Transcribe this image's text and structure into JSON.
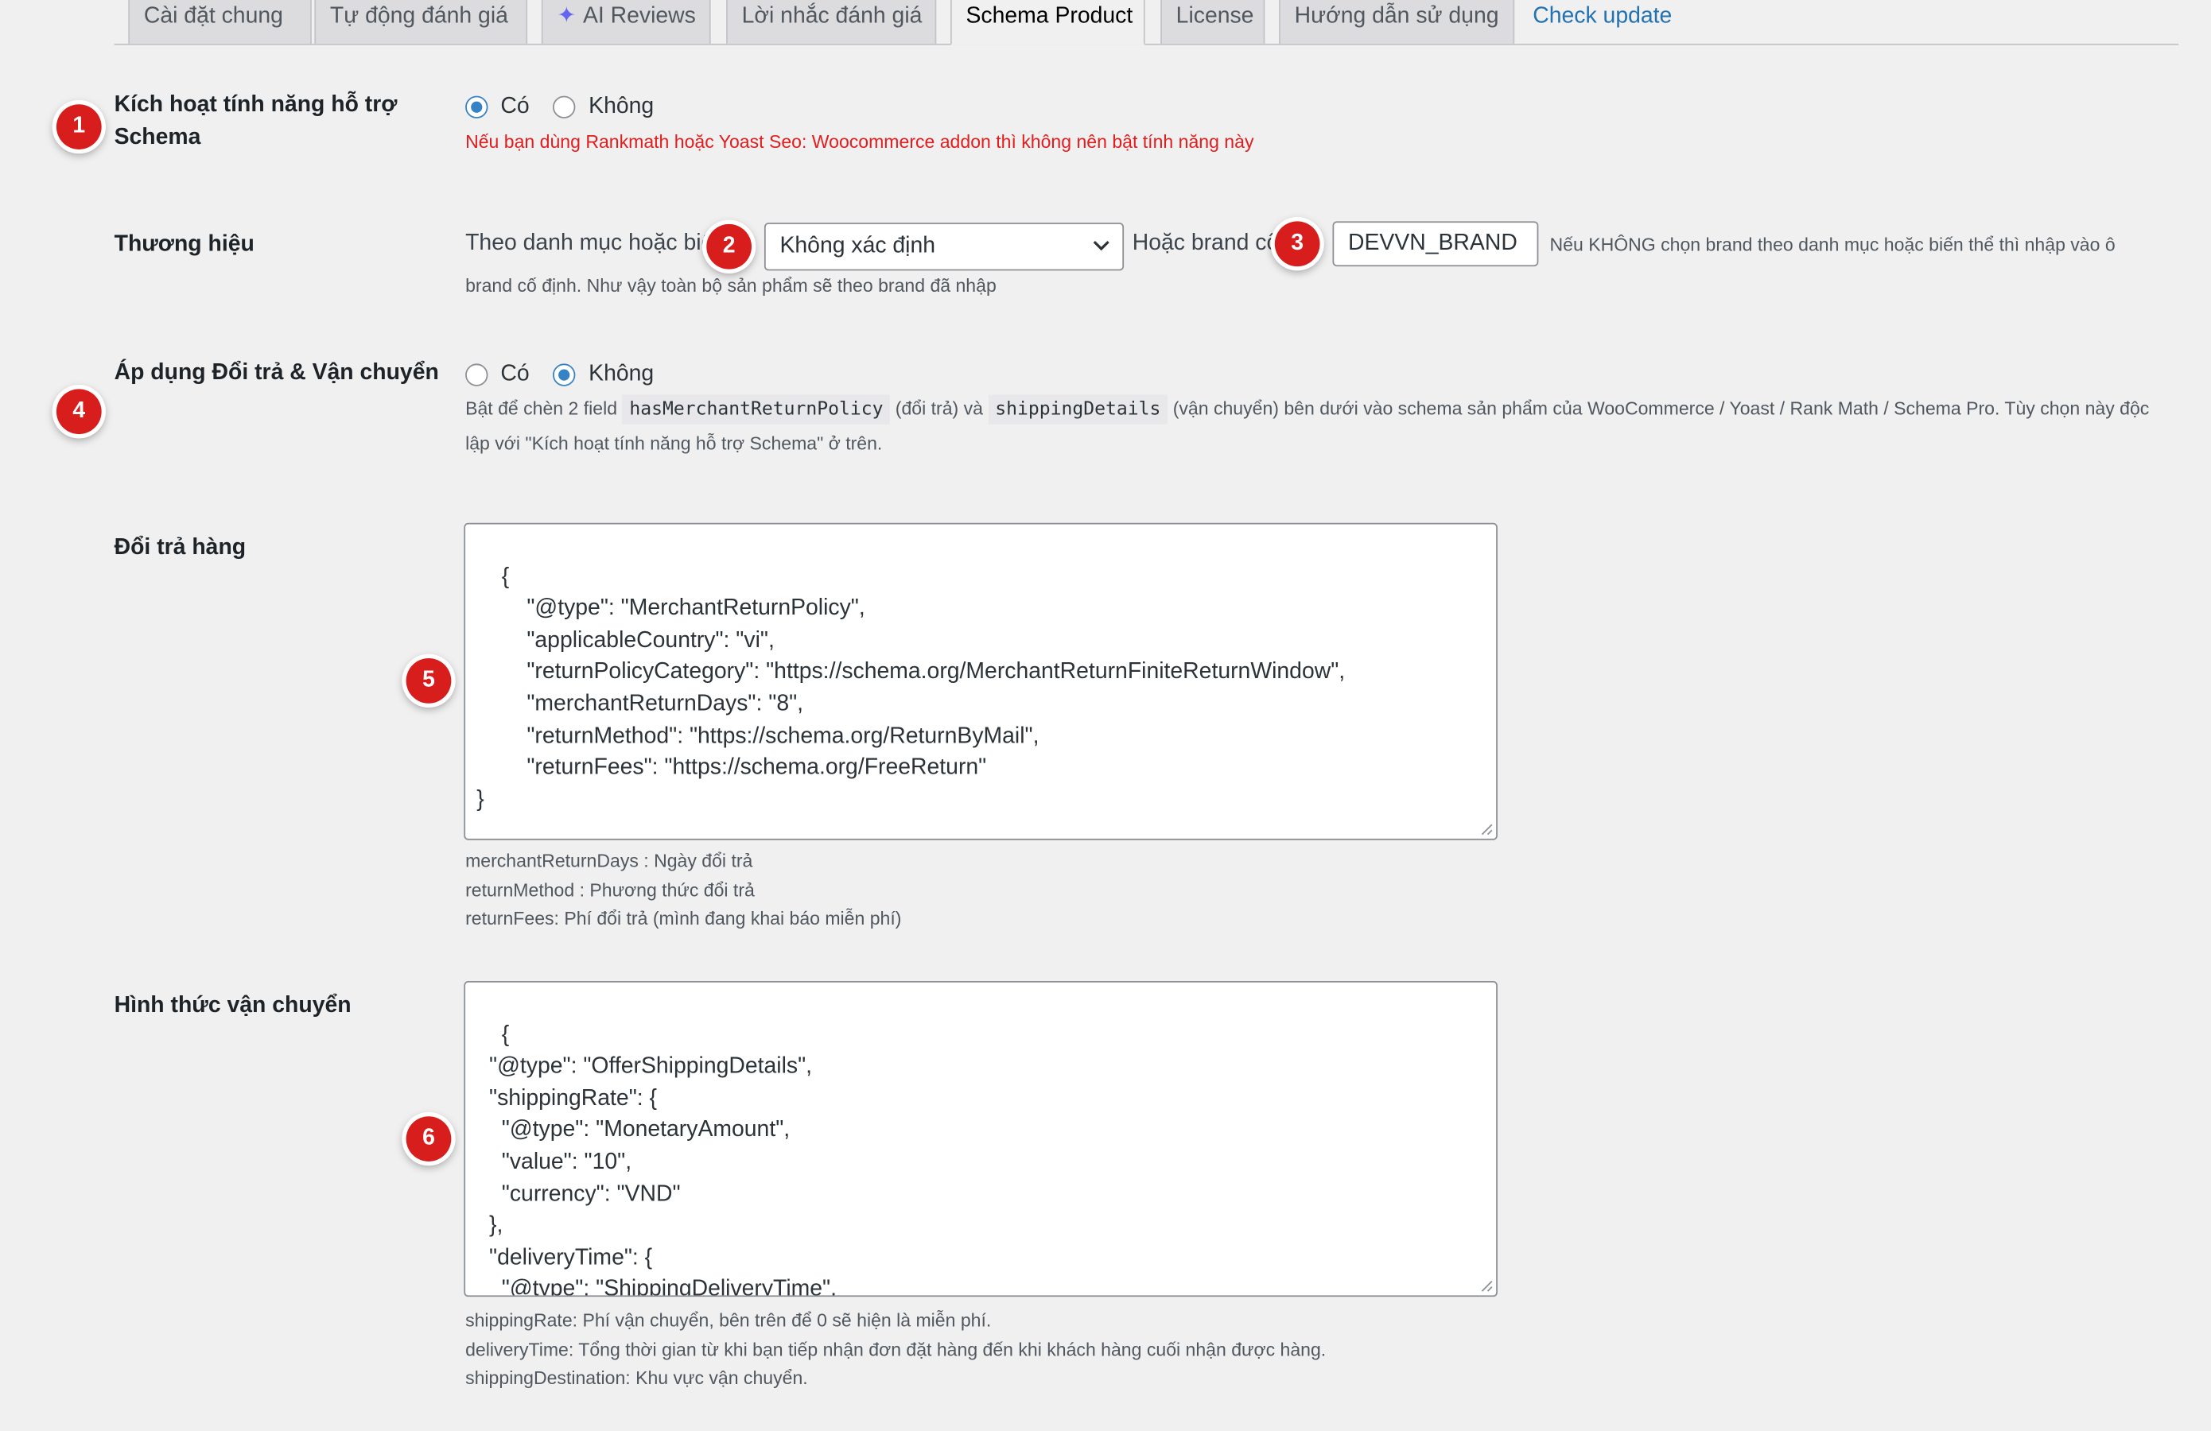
{
  "tabs": [
    {
      "label": "Cài đặt chung"
    },
    {
      "label": "Tự động đánh giá"
    },
    {
      "label": "AI Reviews",
      "icon": "sparkle-icon"
    },
    {
      "label": "Lời nhắc đánh giá"
    },
    {
      "label": "Schema Product",
      "active": true
    },
    {
      "label": "License"
    },
    {
      "label": "Hướng dẫn sử dụng"
    }
  ],
  "check_update": "Check update",
  "schema": {
    "label_line1": "Kích hoạt tính năng hỗ trợ",
    "label_line2": "Schema",
    "options": [
      "Có",
      "Không"
    ],
    "selected": "Có",
    "warning": "Nếu bạn dùng Rankmath hoặc Yoast Seo: Woocommerce addon thì không nên bật tính năng này"
  },
  "brand": {
    "label": "Thương hiệu",
    "by_category_text": "Theo danh mục hoặc biế",
    "select_value": "Không xác định",
    "or_fixed_text": "Hoặc brand cố",
    "input_value": "DEVVN_BRAND",
    "hint_line1": "Nếu KHÔNG chọn brand theo danh mục hoặc biến thể thì nhập vào ô",
    "hint_line2": "brand cố định. Như vậy toàn bộ sản phẩm sẽ theo brand đã nhập"
  },
  "returns_shipping": {
    "label": "Áp dụng Đổi trả & Vận chuyển",
    "options": [
      "Có",
      "Không"
    ],
    "selected": "Không",
    "desc_prefix": "Bật để chèn 2 field",
    "code1": "hasMerchantReturnPolicy",
    "desc_middle": "(đổi trả) và",
    "code2": "shippingDetails",
    "desc_suffix": "(vận chuyển) bên dưới vào schema sản phẩm của WooCommerce / Yoast / Rank Math / Schema Pro. Tùy chọn này độc",
    "desc_line2": "lập với \"Kích hoạt tính năng hỗ trợ Schema\" ở trên."
  },
  "return_policy": {
    "label": "Đổi trả hàng",
    "json_text": "{\n        \"@type\": \"MerchantReturnPolicy\",\n        \"applicableCountry\": \"vi\",\n        \"returnPolicyCategory\": \"https://schema.org/MerchantReturnFiniteReturnWindow\",\n        \"merchantReturnDays\": \"8\",\n        \"returnMethod\": \"https://schema.org/ReturnByMail\",\n        \"returnFees\": \"https://schema.org/FreeReturn\"\n}",
    "notes": [
      "merchantReturnDays : Ngày đổi trả",
      "returnMethod : Phương thức đổi trả",
      "returnFees: Phí đổi trả (mình đang khai báo miễn phí)"
    ]
  },
  "shipping": {
    "label": "Hình thức vận chuyển",
    "json_text": "{\n  \"@type\": \"OfferShippingDetails\",\n  \"shippingRate\": {\n    \"@type\": \"MonetaryAmount\",\n    \"value\": \"10\",\n    \"currency\": \"VND\"\n  },\n  \"deliveryTime\": {\n    \"@type\": \"ShippingDeliveryTime\",\n    \"businessDays\": {",
    "notes": [
      "shippingRate: Phí vận chuyển, bên trên để 0 sẽ hiện là miễn phí.",
      "deliveryTime: Tổng thời gian từ khi bạn tiếp nhận đơn đặt hàng đến khi khách hàng cuối nhận được hàng.",
      "shippingDestination: Khu vực vận chuyển."
    ]
  },
  "annotations": [
    "1",
    "2",
    "3",
    "4",
    "5",
    "6"
  ],
  "colors": {
    "badge": "#d81d1d",
    "warning": "#e11d1d",
    "link": "#2271b1",
    "radio_checked": "#3582c4"
  }
}
